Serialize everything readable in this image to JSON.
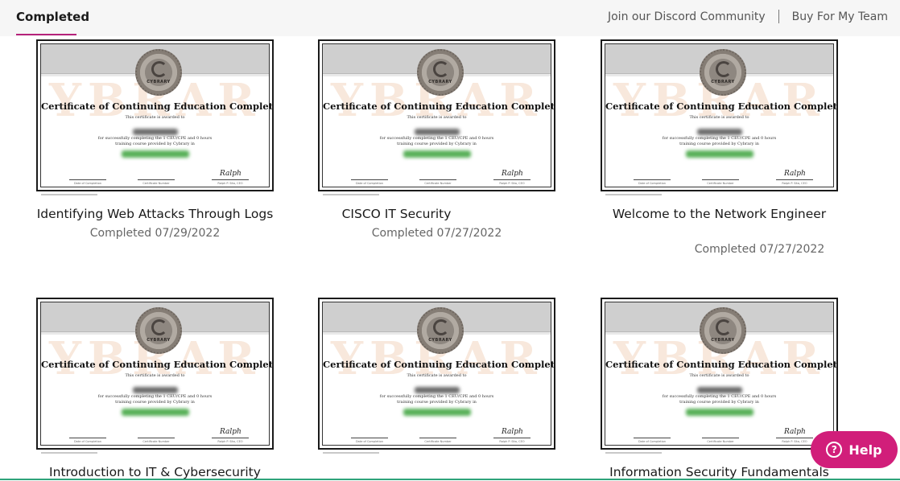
{
  "header": {
    "active_tab": "Completed",
    "nav_links": [
      "Join our Discord Community",
      "Buy For My Team"
    ]
  },
  "certificate": {
    "brand": "CYBRARY",
    "title": "Certificate of Continuing Education Completion",
    "awarded_line": "This certificate is awarded to",
    "completing_line": "for successfully completing the 1 CEU/CPE and 0 hours",
    "provided_line": "training course provided by Cybrary in",
    "watermark": "YBRAR",
    "sig_labels": [
      "Date of Completion",
      "Certificate Number",
      "Ralph P. Sita, CEO"
    ]
  },
  "courses": [
    {
      "title": "Identifying Web Attacks Through Logs",
      "date": "Completed 07/29/2022"
    },
    {
      "title": "CISCO IT Security",
      "date": "Completed 07/27/2022"
    },
    {
      "title": "Welcome to the Network Engineer",
      "date": "Completed 07/27/2022"
    },
    {
      "title": "Introduction to IT & Cybersecurity",
      "date": ""
    },
    {
      "title": "",
      "date": ""
    },
    {
      "title": "Information Security Fundamentals",
      "date": ""
    }
  ],
  "help": {
    "label": "Help",
    "icon": "question-circle-icon"
  },
  "colors": {
    "accent": "#b5227a",
    "help_button": "#d11e7a",
    "bottom_line": "#2fa37a"
  }
}
